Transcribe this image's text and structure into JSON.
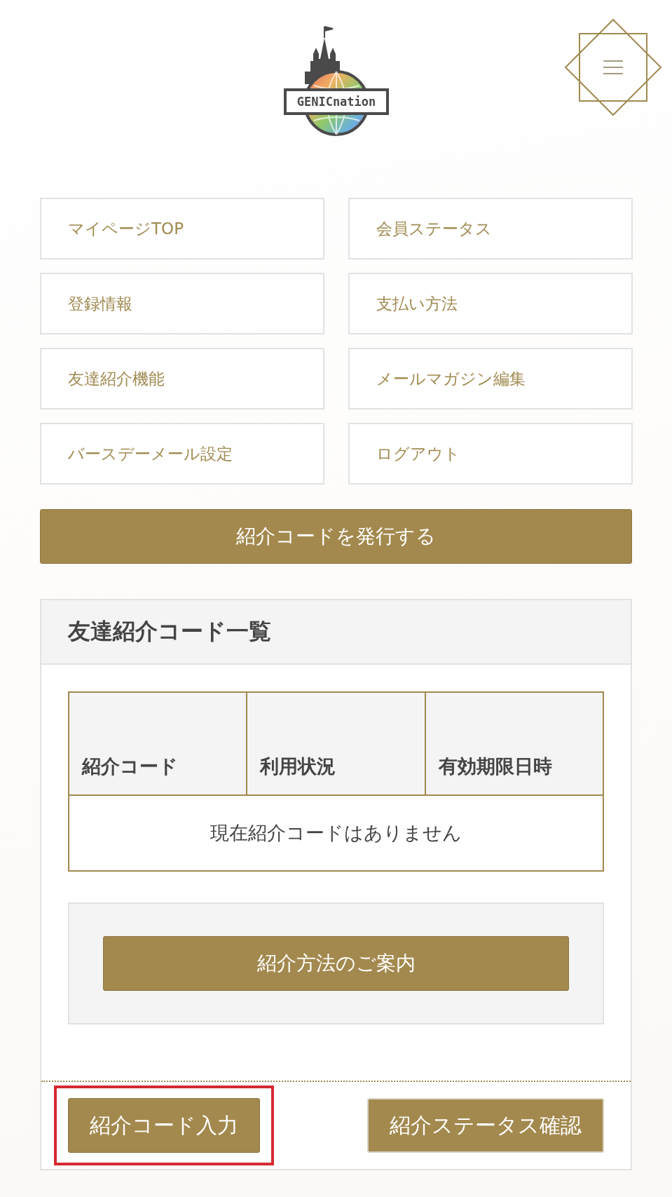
{
  "header": {
    "logo": {
      "text": "GENICnation"
    }
  },
  "menu_links": [
    {
      "label": "マイページTOP"
    },
    {
      "label": "会員ステータス"
    },
    {
      "label": "登録情報"
    },
    {
      "label": "支払い方法"
    },
    {
      "label": "友達紹介機能"
    },
    {
      "label": "メールマガジン編集"
    },
    {
      "label": "バースデーメール設定"
    },
    {
      "label": "ログアウト"
    }
  ],
  "issue_button": "紹介コードを発行する",
  "panel": {
    "title": "友達紹介コード一覧",
    "table": {
      "columns": [
        "紹介コード",
        "利用状況",
        "有効期限日時"
      ],
      "empty_message": "現在紹介コードはありません"
    },
    "guide_button": "紹介方法のご案内",
    "footer_buttons": [
      {
        "label": "紹介コード入力",
        "highlighted": true
      },
      {
        "label": "紹介ステータス確認",
        "highlighted": false
      }
    ]
  }
}
